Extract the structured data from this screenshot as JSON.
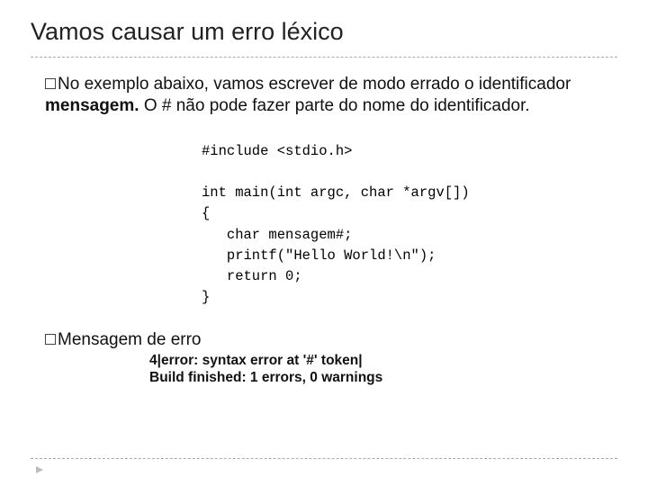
{
  "title": "Vamos causar um erro léxico",
  "p1_a": "No exemplo abaixo, vamos escrever de modo errado o identificador ",
  "p1_b": "mensagem.",
  "p1_c": " O # não pode fazer parte do nome do identificador.",
  "code": "#include <stdio.h>\n\nint main(int argc, char *argv[])\n{\n   char mensagem#;\n   printf(\"Hello World!\\n\");\n   return 0;\n}",
  "p2_a": "Mensagem",
  "p2_b": " de erro",
  "err1": "4|error: syntax error at '#' token|",
  "err2": "Build finished: 1 errors, 0 warnings"
}
